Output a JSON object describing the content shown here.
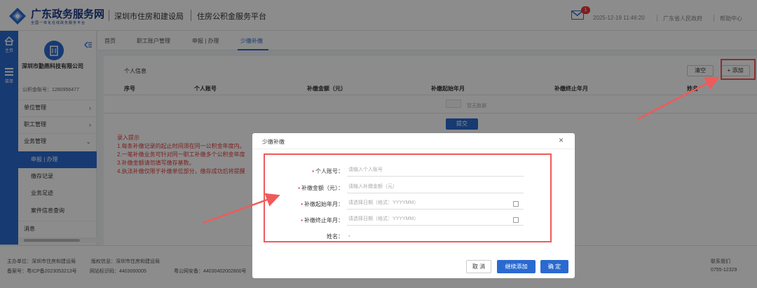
{
  "header": {
    "site_title": "广东政务服务网",
    "site_subtitle": "全国一体化在线政务服务平台",
    "dept": "深圳市住房和建设局",
    "platform": "住房公积金服务平台",
    "mail_badge": "1",
    "datetime": "2025-12-19 11:46:20",
    "gov_link": "广东省人民政府",
    "help_link": "帮助中心"
  },
  "iconbar": {
    "home_label": "主页",
    "menu_label": "菜单"
  },
  "sidebar": {
    "company_name": "深圳市勤燕科技有限公司",
    "fund_no": "公积金账号：1280956477",
    "items": [
      {
        "label": "单位管理",
        "chevron": "›"
      },
      {
        "label": "职工管理",
        "chevron": "›"
      },
      {
        "label": "业务管理",
        "chevron": "⌄"
      }
    ],
    "sub_items": [
      {
        "label": "申报 | 办理"
      },
      {
        "label": "缴存记录"
      },
      {
        "label": "业务足迹"
      },
      {
        "label": "案件信息查询"
      }
    ],
    "last_item": "消息"
  },
  "tabs": [
    "首页",
    "职工账户管理",
    "申报 | 办理",
    "少缴补缴"
  ],
  "panel": {
    "section_title": "个人信息",
    "clear_label": "清空",
    "add_label": "+ 添加",
    "columns": [
      "序号",
      "个人账号",
      "补缴金额（元）",
      "补缴起始年月",
      "补缴终止年月",
      "姓名"
    ],
    "empty_text": "暂无数据",
    "submit_label": "提交",
    "tips": [
      "录入提示",
      "1.每条补缴记录的起止时间须在同一公积金年度内。",
      "2.一笔补缴业务可针对同一职工补缴多个公积金年度",
      "3.补缴金额请勿填写缴存基数。",
      "4.执法补缴仅限于补缴单位部分，缴存成功后将提醒"
    ]
  },
  "footer": {
    "sponsor": "主办单位：深圳市住房和建设局",
    "maintainer": "版权信息：深圳市住房和建设局",
    "icp": "备案号：粤ICP备2023053213号",
    "site_code": "网站标识码：4403000005",
    "police": "粤公网安备：44030402002800号",
    "contact_label": "联系我们",
    "phone": "0755-12329"
  },
  "dialog": {
    "title": "少缴补缴",
    "close": "×",
    "fields": [
      {
        "label": "个人账号",
        "required": true,
        "placeholder": "请输入个人账号"
      },
      {
        "label": "补缴金额（元）",
        "required": true,
        "placeholder": "请输入补缴金额（元）"
      },
      {
        "label": "补缴起始年月",
        "required": true,
        "placeholder": "请选择日期（格式：YYYYMM）"
      },
      {
        "label": "补缴终止年月",
        "required": true,
        "placeholder": "请选择日期（格式：YYYYMM）"
      }
    ],
    "name_label": "姓名：",
    "name_value": "-",
    "cancel_label": "取 消",
    "continue_label": "继续添加",
    "ok_label": "确 定"
  },
  "colors": {
    "primary": "#2a6ad0",
    "annotation_red": "#f05a5a",
    "tip_red": "#e23c3c"
  }
}
